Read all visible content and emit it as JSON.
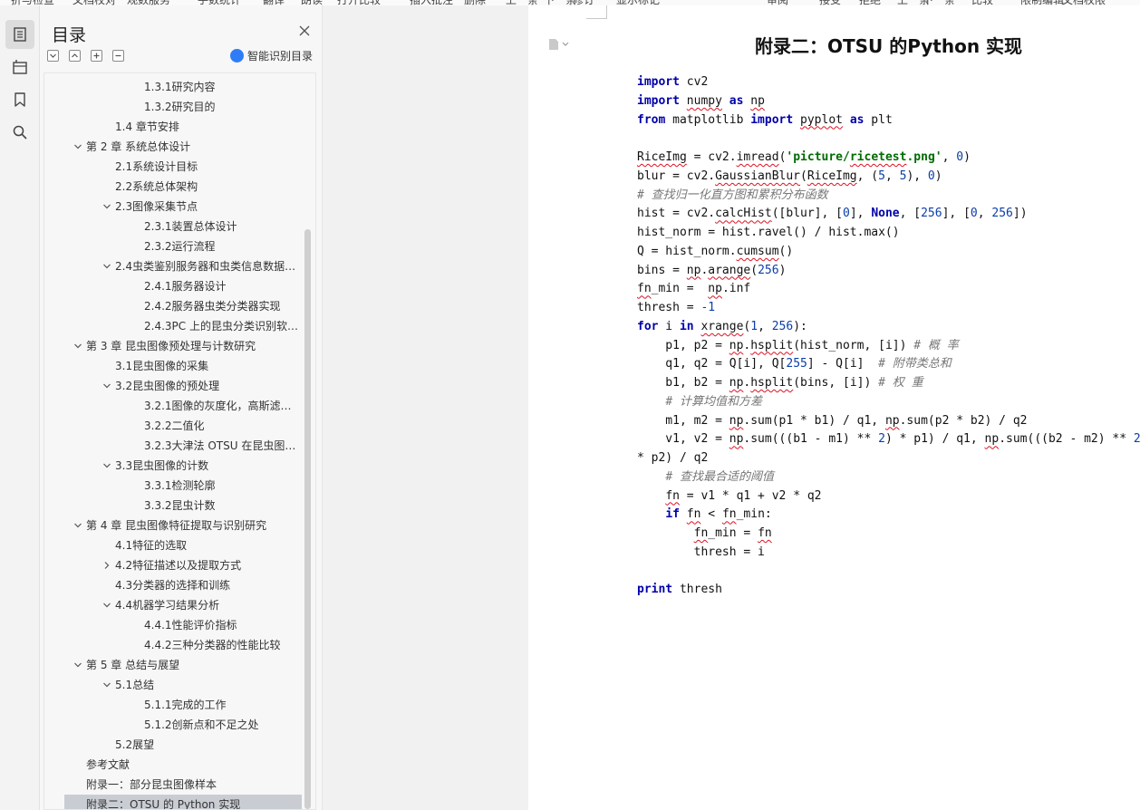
{
  "toolbar": {
    "items": [
      "折与检查",
      "文档校对",
      "观数服务",
      "手数统计",
      "翻译",
      "朗读",
      "打开比较",
      "插入批注",
      "删除",
      "上一条",
      "下一条",
      "修订",
      "显示标记",
      "审阅",
      "接受",
      "拒绝",
      "上一条",
      "下一条",
      "比较",
      "限制编辑",
      "文档权限"
    ]
  },
  "rail": {
    "items": [
      {
        "name": "toc-icon",
        "active": true
      },
      {
        "name": "navigation-icon",
        "active": false
      },
      {
        "name": "bookmark-icon",
        "active": false
      },
      {
        "name": "search-icon",
        "active": false
      }
    ]
  },
  "toc": {
    "title": "目录",
    "smart_label": "智能识别目录",
    "items": [
      {
        "label": "1.3.1研究内容",
        "level": 3,
        "chevron": "none",
        "selected": false
      },
      {
        "label": "1.3.2研究目的",
        "level": 3,
        "chevron": "none",
        "selected": false
      },
      {
        "label": "1.4 章节安排",
        "level": 2,
        "chevron": "none",
        "selected": false
      },
      {
        "label": "第 2 章 系统总体设计",
        "level": 1,
        "chevron": "down",
        "selected": false
      },
      {
        "label": "2.1系统设计目标",
        "level": 2,
        "chevron": "none",
        "selected": false
      },
      {
        "label": "2.2系统总体架构",
        "level": 2,
        "chevron": "none",
        "selected": false
      },
      {
        "label": "2.3图像采集节点",
        "level": 2,
        "chevron": "down",
        "selected": false
      },
      {
        "label": "2.3.1装置总体设计",
        "level": 3,
        "chevron": "none",
        "selected": false
      },
      {
        "label": "2.3.2运行流程",
        "level": 3,
        "chevron": "none",
        "selected": false
      },
      {
        "label": "2.4虫类鉴别服务器和虫类信息数据…",
        "level": 2,
        "chevron": "down",
        "selected": false
      },
      {
        "label": "2.4.1服务器设计",
        "level": 3,
        "chevron": "none",
        "selected": false
      },
      {
        "label": "2.4.2服务器虫类分类器实现",
        "level": 3,
        "chevron": "none",
        "selected": false
      },
      {
        "label": "2.4.3PC 上的昆虫分类识别软…",
        "level": 3,
        "chevron": "none",
        "selected": false
      },
      {
        "label": "第 3 章 昆虫图像预处理与计数研究",
        "level": 1,
        "chevron": "down",
        "selected": false
      },
      {
        "label": "3.1昆虫图像的采集",
        "level": 2,
        "chevron": "none",
        "selected": false
      },
      {
        "label": "3.2昆虫图像的预处理",
        "level": 2,
        "chevron": "down",
        "selected": false
      },
      {
        "label": "3.2.1图像的灰度化，高斯滤…",
        "level": 3,
        "chevron": "none",
        "selected": false
      },
      {
        "label": "3.2.2二值化",
        "level": 3,
        "chevron": "none",
        "selected": false
      },
      {
        "label": "3.2.3大津法 OTSU 在昆虫图…",
        "level": 3,
        "chevron": "none",
        "selected": false
      },
      {
        "label": "3.3昆虫图像的计数",
        "level": 2,
        "chevron": "down",
        "selected": false
      },
      {
        "label": "3.3.1检测轮廓",
        "level": 3,
        "chevron": "none",
        "selected": false
      },
      {
        "label": "3.3.2昆虫计数",
        "level": 3,
        "chevron": "none",
        "selected": false
      },
      {
        "label": "第 4 章 昆虫图像特征提取与识别研究",
        "level": 1,
        "chevron": "down",
        "selected": false
      },
      {
        "label": "4.1特征的选取",
        "level": 2,
        "chevron": "none",
        "selected": false
      },
      {
        "label": "4.2特征描述以及提取方式",
        "level": 2,
        "chevron": "right",
        "selected": false
      },
      {
        "label": "4.3分类器的选择和训练",
        "level": 2,
        "chevron": "none",
        "selected": false
      },
      {
        "label": "4.4机器学习结果分析",
        "level": 2,
        "chevron": "down",
        "selected": false
      },
      {
        "label": "4.4.1性能评价指标",
        "level": 3,
        "chevron": "none",
        "selected": false
      },
      {
        "label": "4.4.2三种分类器的性能比较",
        "level": 3,
        "chevron": "none",
        "selected": false
      },
      {
        "label": "第 5 章 总结与展望",
        "level": 1,
        "chevron": "down",
        "selected": false
      },
      {
        "label": "5.1总结",
        "level": 2,
        "chevron": "down",
        "selected": false
      },
      {
        "label": "5.1.1完成的工作",
        "level": 3,
        "chevron": "none",
        "selected": false
      },
      {
        "label": "5.1.2创新点和不足之处",
        "level": 3,
        "chevron": "none",
        "selected": false
      },
      {
        "label": "5.2展望",
        "level": 2,
        "chevron": "none",
        "selected": false
      },
      {
        "label": "参考文献",
        "level": 1,
        "chevron": "none",
        "selected": false
      },
      {
        "label": "附录一：部分昆虫图像样本",
        "level": 1,
        "chevron": "none",
        "selected": false
      },
      {
        "label": "附录二：OTSU 的 Python 实现",
        "level": 1,
        "chevron": "none",
        "selected": true
      }
    ]
  },
  "document": {
    "title": "附录二：OTSU 的Python 实现",
    "code_lines": [
      [
        [
          "kw",
          "import"
        ],
        [
          "t",
          " cv2"
        ]
      ],
      [
        [
          "kw",
          "import"
        ],
        [
          "t",
          " "
        ],
        [
          "sq",
          "numpy"
        ],
        [
          "t",
          " "
        ],
        [
          "kw",
          "as"
        ],
        [
          "t",
          " "
        ],
        [
          "sq",
          "np"
        ]
      ],
      [
        [
          "kw",
          "from"
        ],
        [
          "t",
          " matplotlib "
        ],
        [
          "kw",
          "import"
        ],
        [
          "t",
          " "
        ],
        [
          "sq",
          "pyplot"
        ],
        [
          "t",
          " "
        ],
        [
          "kw",
          "as"
        ],
        [
          "t",
          " plt"
        ]
      ],
      [],
      [
        [
          "sq",
          "RiceImg"
        ],
        [
          "t",
          " = cv2."
        ],
        [
          "sq",
          "imread"
        ],
        [
          "t",
          "("
        ],
        [
          "str",
          "'picture/"
        ],
        [
          "str sq",
          "ricetest"
        ],
        [
          "str",
          ".png'"
        ],
        [
          "t",
          ", "
        ],
        [
          "num",
          "0"
        ],
        [
          "t",
          ")"
        ]
      ],
      [
        [
          "t",
          "blur = cv2."
        ],
        [
          "sq",
          "GaussianBlur"
        ],
        [
          "t",
          "("
        ],
        [
          "sq",
          "RiceImg"
        ],
        [
          "t",
          ", ("
        ],
        [
          "num",
          "5"
        ],
        [
          "t",
          ", "
        ],
        [
          "num",
          "5"
        ],
        [
          "t",
          "), "
        ],
        [
          "num",
          "0"
        ],
        [
          "t",
          ")"
        ]
      ],
      [
        [
          "cmt",
          "# 查找归一化直方图和累积分布函数"
        ]
      ],
      [
        [
          "t",
          "hist = cv2."
        ],
        [
          "sq",
          "calcHist"
        ],
        [
          "t",
          "([blur], ["
        ],
        [
          "num",
          "0"
        ],
        [
          "t",
          "], "
        ],
        [
          "kw",
          "None"
        ],
        [
          "t",
          ", ["
        ],
        [
          "num",
          "256"
        ],
        [
          "t",
          "], ["
        ],
        [
          "num",
          "0"
        ],
        [
          "t",
          ", "
        ],
        [
          "num",
          "256"
        ],
        [
          "t",
          "])"
        ]
      ],
      [
        [
          "t",
          "hist_norm = hist.ravel() / hist.max()"
        ]
      ],
      [
        [
          "t",
          "Q = hist_norm."
        ],
        [
          "sq",
          "cumsum"
        ],
        [
          "t",
          "()"
        ]
      ],
      [
        [
          "t",
          "bins = "
        ],
        [
          "sq",
          "np"
        ],
        [
          "t",
          "."
        ],
        [
          "sq",
          "arange"
        ],
        [
          "t",
          "("
        ],
        [
          "num",
          "256"
        ],
        [
          "t",
          ")"
        ]
      ],
      [
        [
          "sq",
          "fn"
        ],
        [
          "t",
          "_min =  "
        ],
        [
          "sq",
          "np"
        ],
        [
          "t",
          ".inf"
        ]
      ],
      [
        [
          "t",
          "thresh = "
        ],
        [
          "num",
          "-1"
        ]
      ],
      [
        [
          "kw",
          "for"
        ],
        [
          "t",
          " i "
        ],
        [
          "kw",
          "in"
        ],
        [
          "t",
          " "
        ],
        [
          "sq",
          "xrange"
        ],
        [
          "t",
          "("
        ],
        [
          "num",
          "1"
        ],
        [
          "t",
          ", "
        ],
        [
          "num",
          "256"
        ],
        [
          "t",
          "):"
        ]
      ],
      [
        [
          "t",
          "    p1, p2 = "
        ],
        [
          "sq",
          "np"
        ],
        [
          "t",
          "."
        ],
        [
          "sq",
          "hsplit"
        ],
        [
          "t",
          "(hist_norm, [i]) "
        ],
        [
          "cmt",
          "# 概 率"
        ]
      ],
      [
        [
          "t",
          "    q1, q2 = Q[i], Q["
        ],
        [
          "num",
          "255"
        ],
        [
          "t",
          "] - Q[i]  "
        ],
        [
          "cmt",
          "# 附带类总和"
        ]
      ],
      [
        [
          "t",
          "    b1, b2 = "
        ],
        [
          "sq",
          "np"
        ],
        [
          "t",
          "."
        ],
        [
          "sq",
          "hsplit"
        ],
        [
          "t",
          "(bins, [i]) "
        ],
        [
          "cmt",
          "# 权 重"
        ]
      ],
      [
        [
          "t",
          "    "
        ],
        [
          "cmt",
          "# 计算均值和方差"
        ]
      ],
      [
        [
          "t",
          "    m1, m2 = "
        ],
        [
          "sq",
          "np"
        ],
        [
          "t",
          ".sum(p1 * b1) / q1, "
        ],
        [
          "sq",
          "np"
        ],
        [
          "t",
          ".sum(p2 * b2) / q2"
        ]
      ],
      [
        [
          "t",
          "    v1, v2 = "
        ],
        [
          "sq",
          "np"
        ],
        [
          "t",
          ".sum(((b1 - m1) ** "
        ],
        [
          "num",
          "2"
        ],
        [
          "t",
          ") * p1) / q1, "
        ],
        [
          "sq",
          "np"
        ],
        [
          "t",
          ".sum(((b2 - m2) ** "
        ],
        [
          "num",
          "2"
        ],
        [
          "t",
          ")"
        ]
      ],
      [
        [
          "t",
          "* p2) / q2"
        ]
      ],
      [
        [
          "t",
          "    "
        ],
        [
          "cmt",
          "# 查找最合适的阈值"
        ]
      ],
      [
        [
          "t",
          "    "
        ],
        [
          "sq",
          "fn"
        ],
        [
          "t",
          " = v1 * q1 + v2 * q2"
        ]
      ],
      [
        [
          "t",
          "    "
        ],
        [
          "kw",
          "if"
        ],
        [
          "t",
          " "
        ],
        [
          "sq",
          "fn"
        ],
        [
          "t",
          " < "
        ],
        [
          "sq",
          "fn"
        ],
        [
          "t",
          "_min:"
        ]
      ],
      [
        [
          "t",
          "        "
        ],
        [
          "sq",
          "fn"
        ],
        [
          "t",
          "_min = "
        ],
        [
          "sq",
          "fn"
        ]
      ],
      [
        [
          "t",
          "        thresh = i"
        ]
      ],
      [],
      [
        [
          "kw",
          "print"
        ],
        [
          "t",
          " thresh"
        ]
      ]
    ]
  }
}
